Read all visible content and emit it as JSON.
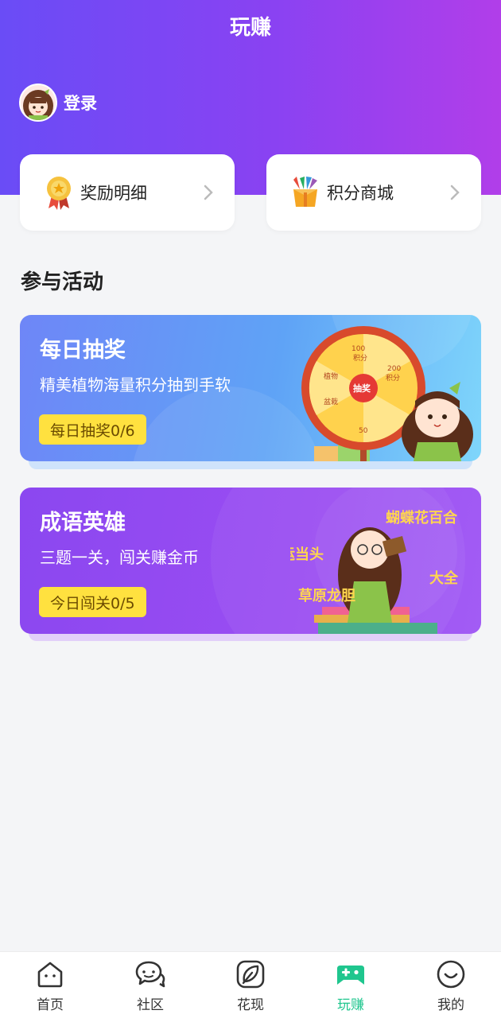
{
  "header": {
    "title": "玩赚",
    "login_label": "登录"
  },
  "quick_links": [
    {
      "label": "奖励明细",
      "icon": "medal-icon"
    },
    {
      "label": "积分商城",
      "icon": "gift-box-icon"
    }
  ],
  "section": {
    "title": "参与活动"
  },
  "activities": [
    {
      "title": "每日抽奖",
      "description": "精美植物海量积分抽到手软",
      "badge": "每日抽奖0/6",
      "art": {
        "wheel_center": "抽奖",
        "wheel_labels": [
          "100",
          "积分",
          "200",
          "积分",
          "50",
          "植物",
          "盆栽"
        ]
      }
    },
    {
      "title": "成语英雄",
      "description": "三题一关，闯关赚金币",
      "badge": "今日闯关0/5",
      "art": {
        "words": [
          "蝴蝶花百合",
          "红运当头",
          "大全",
          "草原龙胆"
        ]
      }
    }
  ],
  "tabbar": [
    {
      "label": "首页",
      "icon": "home-icon",
      "active": false
    },
    {
      "label": "社区",
      "icon": "chat-bubbles-icon",
      "active": false
    },
    {
      "label": "花现",
      "icon": "leaf-icon",
      "active": false
    },
    {
      "label": "玩赚",
      "icon": "gamepad-icon",
      "active": true
    },
    {
      "label": "我的",
      "icon": "smiley-icon",
      "active": false
    }
  ],
  "colors": {
    "header_gradient_start": "#6a4cf6",
    "header_gradient_end": "#b13ee9",
    "accent_green": "#1fc68e",
    "badge_yellow": "#ffe13f"
  }
}
